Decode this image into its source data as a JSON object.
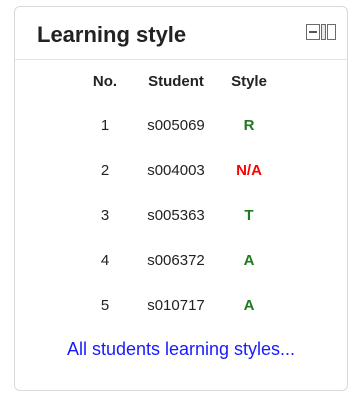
{
  "block": {
    "title": "Learning style",
    "dock_icon": "dock-block-icon"
  },
  "table": {
    "headers": [
      "No.",
      "Student",
      "Style"
    ],
    "rows": [
      {
        "no": "1",
        "student": "s005069",
        "style": "R",
        "style_color": "#1f7a1f"
      },
      {
        "no": "2",
        "student": "s004003",
        "style": "N/A",
        "style_color": "#ff0000"
      },
      {
        "no": "3",
        "student": "s005363",
        "style": "T",
        "style_color": "#1f7a1f"
      },
      {
        "no": "4",
        "student": "s006372",
        "style": "A",
        "style_color": "#1f7a1f"
      },
      {
        "no": "5",
        "student": "s010717",
        "style": "A",
        "style_color": "#1f7a1f"
      }
    ]
  },
  "footer": {
    "link_text": "All students learning styles..."
  },
  "colors": {
    "link": "#1a1aff",
    "style_ok": "#1f7a1f",
    "style_na": "#ff0000",
    "border": "#d9d9d9"
  }
}
